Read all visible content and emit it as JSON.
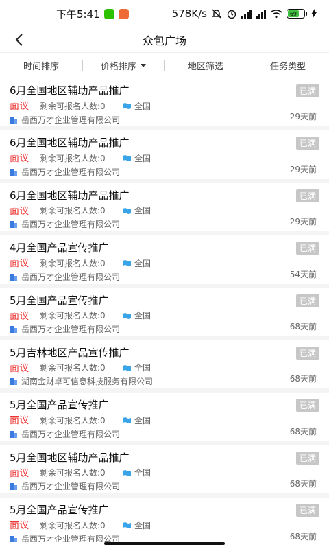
{
  "status_bar": {
    "time": "下午5:41",
    "network_speed": "578K/s",
    "battery_level": "69",
    "icons": [
      "wechat-icon",
      "app-icon",
      "bell-off-icon",
      "alarm-icon",
      "signal-hd-icon",
      "signal-hd-icon",
      "wifi-icon",
      "battery-icon",
      "charging-icon"
    ],
    "colors": {
      "wechat": "#2dc100",
      "app": "#f06a35",
      "battery_fill": "#3fbf3f"
    }
  },
  "nav": {
    "title": "众包广场"
  },
  "filters": [
    {
      "label": "时间排序"
    },
    {
      "label": "价格排序"
    },
    {
      "label": "地区筛选"
    },
    {
      "label": "任务类型"
    }
  ],
  "colors": {
    "price": "#ee3333",
    "badge": "#c7c7c7",
    "region_icon": "#3aa4e8",
    "company_icon": "#3b7be0"
  },
  "tasks": [
    {
      "title": "6月全国地区辅助产品推广",
      "badge": "已满",
      "price": "面议",
      "remaining": "剩余可报名人数:0",
      "region": "全国",
      "company": "岳西万才企业管理有限公司",
      "time": "29天前"
    },
    {
      "title": "6月全国地区辅助产品推广",
      "badge": "已满",
      "price": "面议",
      "remaining": "剩余可报名人数:0",
      "region": "全国",
      "company": "岳西万才企业管理有限公司",
      "time": "29天前"
    },
    {
      "title": "6月全国地区辅助产品推广",
      "badge": "已满",
      "price": "面议",
      "remaining": "剩余可报名人数:0",
      "region": "全国",
      "company": "岳西万才企业管理有限公司",
      "time": "29天前"
    },
    {
      "title": "4月全国产品宣传推广",
      "badge": "已满",
      "price": "面议",
      "remaining": "剩余可报名人数:0",
      "region": "全国",
      "company": "岳西万才企业管理有限公司",
      "time": "54天前"
    },
    {
      "title": "5月全国产品宣传推广",
      "badge": "已满",
      "price": "面议",
      "remaining": "剩余可报名人数:0",
      "region": "全国",
      "company": "岳西万才企业管理有限公司",
      "time": "68天前"
    },
    {
      "title": "5月吉林地区产品宣传推广",
      "badge": "已满",
      "price": "面议",
      "remaining": "剩余可报名人数:0",
      "region": "全国",
      "company": "湖南金财卓可信息科技服务有限公司",
      "time": "68天前"
    },
    {
      "title": "5月全国产品宣传推广",
      "badge": "已满",
      "price": "面议",
      "remaining": "剩余可报名人数:0",
      "region": "全国",
      "company": "岳西万才企业管理有限公司",
      "time": "68天前"
    },
    {
      "title": "5月全国地区辅助产品推广",
      "badge": "已满",
      "price": "面议",
      "remaining": "剩余可报名人数:0",
      "region": "全国",
      "company": "岳西万才企业管理有限公司",
      "time": "68天前"
    },
    {
      "title": "5月全国产品宣传推广",
      "badge": "已满",
      "price": "面议",
      "remaining": "剩余可报名人数:0",
      "region": "全国",
      "company": "岳西万才企业管理有限公司",
      "time": "68天前"
    }
  ]
}
